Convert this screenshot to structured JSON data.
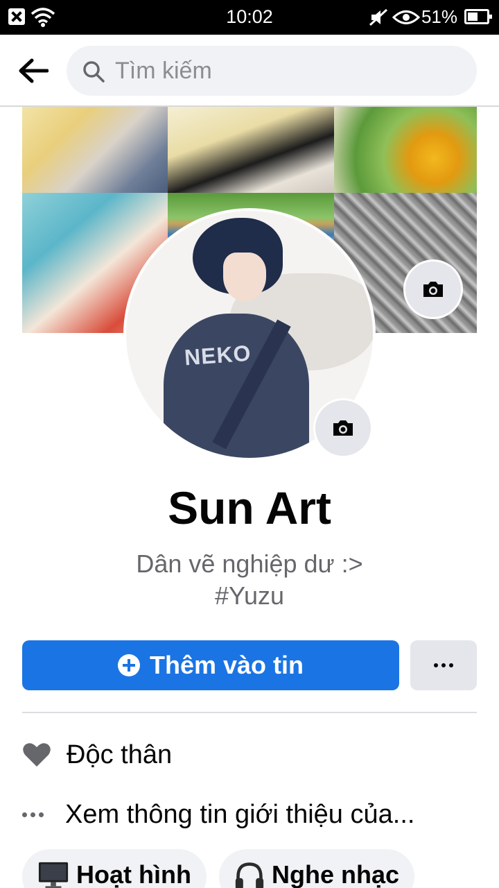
{
  "status_bar": {
    "time": "10:02",
    "battery_percent": "51%",
    "icons": [
      "close-notification-icon",
      "wifi-icon",
      "mute-icon",
      "eye-icon",
      "battery-icon"
    ]
  },
  "top_nav": {
    "back_icon": "arrow-left-icon",
    "search": {
      "placeholder": "Tìm kiếm",
      "icon": "search-icon"
    }
  },
  "cover": {
    "camera_icon": "camera-icon"
  },
  "avatar": {
    "overlay_text": "NEKO",
    "camera_icon": "camera-icon"
  },
  "profile": {
    "name": "Sun Art",
    "bio_line_1": "Dân vẽ nghiệp dư :>",
    "bio_line_2": "#Yuzu"
  },
  "actions": {
    "add_story_label": "Thêm vào tin",
    "add_story_icon": "plus-circle-icon",
    "more_icon": "more-dots-icon",
    "primary_color": "#1b74e4"
  },
  "info": {
    "relationship_status": "Độc thân",
    "relationship_icon": "heart-icon",
    "about_link": "Xem thông tin giới thiệu của...",
    "about_icon": "more-dots-icon"
  },
  "hobbies": [
    {
      "icon": "tv-icon",
      "label": "Hoạt hình"
    },
    {
      "icon": "headphones-icon",
      "label": "Nghe nhạc"
    }
  ]
}
